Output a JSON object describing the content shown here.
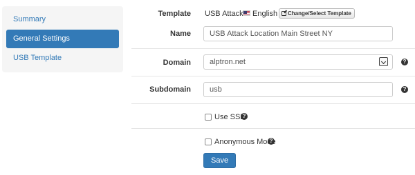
{
  "sidebar": {
    "items": [
      {
        "label": "Summary"
      },
      {
        "label": "General Settings"
      },
      {
        "label": "USB Template"
      }
    ]
  },
  "template": {
    "label": "Template",
    "name": "USB Attack /",
    "language": "English",
    "change_button": "Change/Select Template"
  },
  "name_field": {
    "label": "Name",
    "value": "USB Attack Location Main Street NY"
  },
  "domain_field": {
    "label": "Domain",
    "value": "alptron.net"
  },
  "subdomain_field": {
    "label": "Subdomain",
    "value": "usb"
  },
  "use_ssl": {
    "label": "Use SSL"
  },
  "anonymous_mode": {
    "label": "Anonymous Mode"
  },
  "save_button": "Save",
  "help_glyph": "?"
}
